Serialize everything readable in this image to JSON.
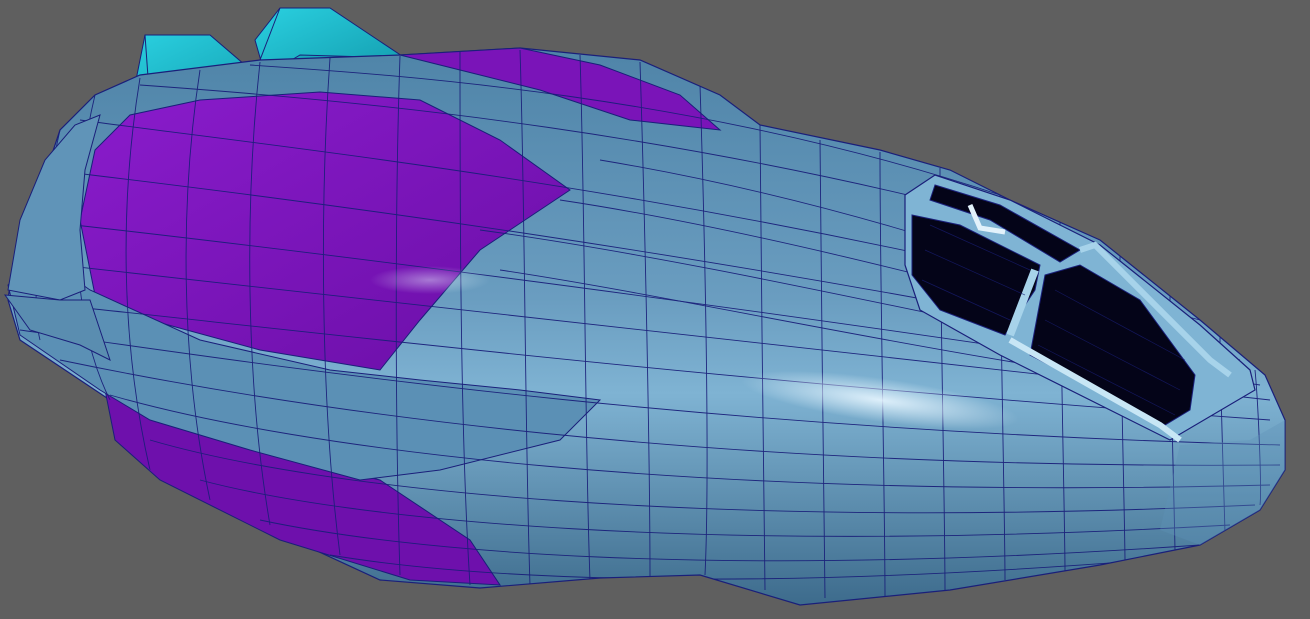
{
  "scene": {
    "subject": "spaceship-wireframe-model",
    "colors": {
      "background": "#5f5f5f",
      "hull": "#5a8fb3",
      "hull_shadow": "#3f6d8e",
      "hull_highlight": "#cfe6f4",
      "purple_panel": "#7b12b8",
      "purple_dark": "#5a0a8c",
      "fin": "#1fb7c9",
      "fin_dark": "#149aaa",
      "wire": "#1a1f7a",
      "canopy_glass": "#040418",
      "canopy_frame": "#8fc2dc"
    }
  }
}
